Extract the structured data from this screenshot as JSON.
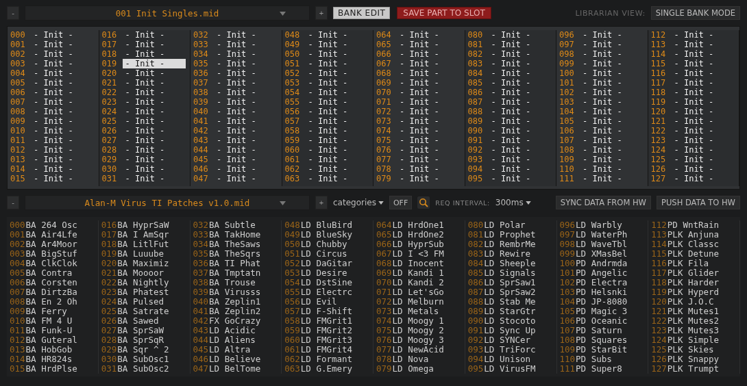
{
  "top_bar": {
    "minus": "-",
    "file": "001 Init Singles.mid",
    "plus": "+",
    "bank_edit": {
      "label": "BANK EDIT",
      "on": true
    },
    "save_button": "SAVE PART TO SLOT",
    "view_label": "LIBRARIAN VIEW:",
    "view_mode": "SINGLE BANK MODE"
  },
  "bank_patches": [
    {
      "number": "000",
      "name": "- Init -",
      "selected": false
    },
    {
      "number": "001",
      "name": "- Init -",
      "selected": false
    },
    {
      "number": "002",
      "name": "- Init -",
      "selected": false
    },
    {
      "number": "003",
      "name": "- Init -",
      "selected": false
    },
    {
      "number": "004",
      "name": "- Init -",
      "selected": false
    },
    {
      "number": "005",
      "name": "- Init -",
      "selected": false
    },
    {
      "number": "006",
      "name": "- Init -",
      "selected": false
    },
    {
      "number": "007",
      "name": "- Init -",
      "selected": false
    },
    {
      "number": "008",
      "name": "- Init -",
      "selected": false
    },
    {
      "number": "009",
      "name": "- Init -",
      "selected": false
    },
    {
      "number": "010",
      "name": "- Init -",
      "selected": false
    },
    {
      "number": "011",
      "name": "- Init -",
      "selected": false
    },
    {
      "number": "012",
      "name": "- Init -",
      "selected": false
    },
    {
      "number": "013",
      "name": "- Init -",
      "selected": false
    },
    {
      "number": "014",
      "name": "- Init -",
      "selected": false
    },
    {
      "number": "015",
      "name": "- Init -",
      "selected": false
    },
    {
      "number": "016",
      "name": "- Init -",
      "selected": false
    },
    {
      "number": "017",
      "name": "- Init -",
      "selected": false
    },
    {
      "number": "018",
      "name": "- Init -",
      "selected": false
    },
    {
      "number": "019",
      "name": "- Init -",
      "selected": true
    },
    {
      "number": "020",
      "name": "- Init -",
      "selected": false
    },
    {
      "number": "021",
      "name": "- Init -",
      "selected": false
    },
    {
      "number": "022",
      "name": "- Init -",
      "selected": false
    },
    {
      "number": "023",
      "name": "- Init -",
      "selected": false
    },
    {
      "number": "024",
      "name": "- Init -",
      "selected": false
    },
    {
      "number": "025",
      "name": "- Init -",
      "selected": false
    },
    {
      "number": "026",
      "name": "- Init -",
      "selected": false
    },
    {
      "number": "027",
      "name": "- Init -",
      "selected": false
    },
    {
      "number": "028",
      "name": "- Init -",
      "selected": false
    },
    {
      "number": "029",
      "name": "- Init -",
      "selected": false
    },
    {
      "number": "030",
      "name": "- Init -",
      "selected": false
    },
    {
      "number": "031",
      "name": "- Init -",
      "selected": false
    },
    {
      "number": "032",
      "name": "- Init -",
      "selected": false
    },
    {
      "number": "033",
      "name": "- Init -",
      "selected": false
    },
    {
      "number": "034",
      "name": "- Init -",
      "selected": false
    },
    {
      "number": "035",
      "name": "- Init -",
      "selected": false
    },
    {
      "number": "036",
      "name": "- Init -",
      "selected": false
    },
    {
      "number": "037",
      "name": "- Init -",
      "selected": false
    },
    {
      "number": "038",
      "name": "- Init -",
      "selected": false
    },
    {
      "number": "039",
      "name": "- Init -",
      "selected": false
    },
    {
      "number": "040",
      "name": "- Init -",
      "selected": false
    },
    {
      "number": "041",
      "name": "- Init -",
      "selected": false
    },
    {
      "number": "042",
      "name": "- Init -",
      "selected": false
    },
    {
      "number": "043",
      "name": "- Init -",
      "selected": false
    },
    {
      "number": "044",
      "name": "- Init -",
      "selected": false
    },
    {
      "number": "045",
      "name": "- Init -",
      "selected": false
    },
    {
      "number": "046",
      "name": "- Init -",
      "selected": false
    },
    {
      "number": "047",
      "name": "- Init -",
      "selected": false
    },
    {
      "number": "048",
      "name": "- Init -",
      "selected": false
    },
    {
      "number": "049",
      "name": "- Init -",
      "selected": false
    },
    {
      "number": "050",
      "name": "- Init -",
      "selected": false
    },
    {
      "number": "051",
      "name": "- Init -",
      "selected": false
    },
    {
      "number": "052",
      "name": "- Init -",
      "selected": false
    },
    {
      "number": "053",
      "name": "- Init -",
      "selected": false
    },
    {
      "number": "054",
      "name": "- Init -",
      "selected": false
    },
    {
      "number": "055",
      "name": "- Init -",
      "selected": false
    },
    {
      "number": "056",
      "name": "- Init -",
      "selected": false
    },
    {
      "number": "057",
      "name": "- Init -",
      "selected": false
    },
    {
      "number": "058",
      "name": "- Init -",
      "selected": false
    },
    {
      "number": "059",
      "name": "- Init -",
      "selected": false
    },
    {
      "number": "060",
      "name": "- Init -",
      "selected": false
    },
    {
      "number": "061",
      "name": "- Init -",
      "selected": false
    },
    {
      "number": "062",
      "name": "- Init -",
      "selected": false
    },
    {
      "number": "063",
      "name": "- Init -",
      "selected": false
    },
    {
      "number": "064",
      "name": "- Init -",
      "selected": false
    },
    {
      "number": "065",
      "name": "- Init -",
      "selected": false
    },
    {
      "number": "066",
      "name": "- Init -",
      "selected": false
    },
    {
      "number": "067",
      "name": "- Init -",
      "selected": false
    },
    {
      "number": "068",
      "name": "- Init -",
      "selected": false
    },
    {
      "number": "069",
      "name": "- Init -",
      "selected": false
    },
    {
      "number": "070",
      "name": "- Init -",
      "selected": false
    },
    {
      "number": "071",
      "name": "- Init -",
      "selected": false
    },
    {
      "number": "072",
      "name": "- Init -",
      "selected": false
    },
    {
      "number": "073",
      "name": "- Init -",
      "selected": false
    },
    {
      "number": "074",
      "name": "- Init -",
      "selected": false
    },
    {
      "number": "075",
      "name": "- Init -",
      "selected": false
    },
    {
      "number": "076",
      "name": "- Init -",
      "selected": false
    },
    {
      "number": "077",
      "name": "- Init -",
      "selected": false
    },
    {
      "number": "078",
      "name": "- Init -",
      "selected": false
    },
    {
      "number": "079",
      "name": "- Init -",
      "selected": false
    },
    {
      "number": "080",
      "name": "- Init -",
      "selected": false
    },
    {
      "number": "081",
      "name": "- Init -",
      "selected": false
    },
    {
      "number": "082",
      "name": "- Init -",
      "selected": false
    },
    {
      "number": "083",
      "name": "- Init -",
      "selected": false
    },
    {
      "number": "084",
      "name": "- Init -",
      "selected": false
    },
    {
      "number": "085",
      "name": "- Init -",
      "selected": false
    },
    {
      "number": "086",
      "name": "- Init -",
      "selected": false
    },
    {
      "number": "087",
      "name": "- Init -",
      "selected": false
    },
    {
      "number": "088",
      "name": "- Init -",
      "selected": false
    },
    {
      "number": "089",
      "name": "- Init -",
      "selected": false
    },
    {
      "number": "090",
      "name": "- Init -",
      "selected": false
    },
    {
      "number": "091",
      "name": "- Init -",
      "selected": false
    },
    {
      "number": "092",
      "name": "- Init -",
      "selected": false
    },
    {
      "number": "093",
      "name": "- Init -",
      "selected": false
    },
    {
      "number": "094",
      "name": "- Init -",
      "selected": false
    },
    {
      "number": "095",
      "name": "- Init -",
      "selected": false
    },
    {
      "number": "096",
      "name": "- Init -",
      "selected": false
    },
    {
      "number": "097",
      "name": "- Init -",
      "selected": false
    },
    {
      "number": "098",
      "name": "- Init -",
      "selected": false
    },
    {
      "number": "099",
      "name": "- Init -",
      "selected": false
    },
    {
      "number": "100",
      "name": "- Init -",
      "selected": false
    },
    {
      "number": "101",
      "name": "- Init -",
      "selected": false
    },
    {
      "number": "102",
      "name": "- Init -",
      "selected": false
    },
    {
      "number": "103",
      "name": "- Init -",
      "selected": false
    },
    {
      "number": "104",
      "name": "- Init -",
      "selected": false
    },
    {
      "number": "105",
      "name": "- Init -",
      "selected": false
    },
    {
      "number": "106",
      "name": "- Init -",
      "selected": false
    },
    {
      "number": "107",
      "name": "- Init -",
      "selected": false
    },
    {
      "number": "108",
      "name": "- Init -",
      "selected": false
    },
    {
      "number": "109",
      "name": "- Init -",
      "selected": false
    },
    {
      "number": "110",
      "name": "- Init -",
      "selected": false
    },
    {
      "number": "111",
      "name": "- Init -",
      "selected": false
    },
    {
      "number": "112",
      "name": "- Init -",
      "selected": false
    },
    {
      "number": "113",
      "name": "- Init -",
      "selected": false
    },
    {
      "number": "114",
      "name": "- Init -",
      "selected": false
    },
    {
      "number": "115",
      "name": "- Init -",
      "selected": false
    },
    {
      "number": "116",
      "name": "- Init -",
      "selected": false
    },
    {
      "number": "117",
      "name": "- Init -",
      "selected": false
    },
    {
      "number": "118",
      "name": "- Init -",
      "selected": false
    },
    {
      "number": "119",
      "name": "- Init -",
      "selected": false
    },
    {
      "number": "120",
      "name": "- Init -",
      "selected": false
    },
    {
      "number": "121",
      "name": "- Init -",
      "selected": false
    },
    {
      "number": "122",
      "name": "- Init -",
      "selected": false
    },
    {
      "number": "123",
      "name": "- Init -",
      "selected": false
    },
    {
      "number": "124",
      "name": "- Init -",
      "selected": false
    },
    {
      "number": "125",
      "name": "- Init -",
      "selected": false
    },
    {
      "number": "126",
      "name": "- Init -",
      "selected": false
    },
    {
      "number": "127",
      "name": "- Init -",
      "selected": false
    }
  ],
  "library_bar": {
    "minus": "-",
    "file": "Alan-M Virus TI Patches v1.0.mid",
    "plus": "+",
    "categories": "categories",
    "off_button": "OFF",
    "interval_label": "REQ INTERVAL:",
    "interval": "300ms",
    "sync_button": "SYNC DATA FROM HW",
    "push_button": "PUSH DATA TO HW"
  },
  "library_patches": [
    {
      "number": "000",
      "category": "BA",
      "name": "264 Osc"
    },
    {
      "number": "001",
      "category": "BA",
      "name": "Air4Lfe"
    },
    {
      "number": "002",
      "category": "BA",
      "name": "Ar4Moor"
    },
    {
      "number": "003",
      "category": "BA",
      "name": "BigStuf"
    },
    {
      "number": "004",
      "category": "BA",
      "name": "ClkClok"
    },
    {
      "number": "005",
      "category": "BA",
      "name": "Contra"
    },
    {
      "number": "006",
      "category": "BA",
      "name": "Corsten"
    },
    {
      "number": "007",
      "category": "BA",
      "name": "DirtzBa"
    },
    {
      "number": "008",
      "category": "BA",
      "name": "En 2 Oh"
    },
    {
      "number": "009",
      "category": "BA",
      "name": "Ferry"
    },
    {
      "number": "010",
      "category": "BA",
      "name": "FM 4 U"
    },
    {
      "number": "011",
      "category": "BA",
      "name": "Funk-U"
    },
    {
      "number": "012",
      "category": "BA",
      "name": "Guteral"
    },
    {
      "number": "013",
      "category": "BA",
      "name": "HobGob"
    },
    {
      "number": "014",
      "category": "BA",
      "name": "HR824s"
    },
    {
      "number": "015",
      "category": "BA",
      "name": "HrdPlse"
    },
    {
      "number": "016",
      "category": "BA",
      "name": "HyprSaW"
    },
    {
      "number": "017",
      "category": "BA",
      "name": "I AmSqr"
    },
    {
      "number": "018",
      "category": "BA",
      "name": "LitlFut"
    },
    {
      "number": "019",
      "category": "BA",
      "name": "Luuube"
    },
    {
      "number": "020",
      "category": "BA",
      "name": "Maximiz"
    },
    {
      "number": "021",
      "category": "BA",
      "name": "Moooor"
    },
    {
      "number": "022",
      "category": "BA",
      "name": "Nightly"
    },
    {
      "number": "023",
      "category": "BA",
      "name": "Phatest"
    },
    {
      "number": "024",
      "category": "BA",
      "name": "Pulsed"
    },
    {
      "number": "025",
      "category": "BA",
      "name": "Satrate"
    },
    {
      "number": "026",
      "category": "BA",
      "name": "Sawed"
    },
    {
      "number": "027",
      "category": "BA",
      "name": "SprSaW"
    },
    {
      "number": "028",
      "category": "BA",
      "name": "SprSqR"
    },
    {
      "number": "029",
      "category": "BA",
      "name": "Sqr ^ 2"
    },
    {
      "number": "030",
      "category": "BA",
      "name": "SubOsc1"
    },
    {
      "number": "031",
      "category": "BA",
      "name": "SubOsc2"
    },
    {
      "number": "032",
      "category": "BA",
      "name": "Subtle"
    },
    {
      "number": "033",
      "category": "BA",
      "name": "TakHome"
    },
    {
      "number": "034",
      "category": "BA",
      "name": "TheSaws"
    },
    {
      "number": "035",
      "category": "BA",
      "name": "TheSqrs"
    },
    {
      "number": "036",
      "category": "BA",
      "name": "TI Phat"
    },
    {
      "number": "037",
      "category": "BA",
      "name": "Tmptatn"
    },
    {
      "number": "038",
      "category": "BA",
      "name": "Trouse"
    },
    {
      "number": "039",
      "category": "BA",
      "name": "Virusss"
    },
    {
      "number": "040",
      "category": "BA",
      "name": "Zeplin1"
    },
    {
      "number": "041",
      "category": "BA",
      "name": "Zeplin2"
    },
    {
      "number": "042",
      "category": "FX",
      "name": "GoCrazy"
    },
    {
      "number": "043",
      "category": "LD",
      "name": "Acidic"
    },
    {
      "number": "044",
      "category": "LD",
      "name": "Aliens"
    },
    {
      "number": "045",
      "category": "LD",
      "name": "Altra"
    },
    {
      "number": "046",
      "category": "LD",
      "name": "Believe"
    },
    {
      "number": "047",
      "category": "LD",
      "name": "BelTome"
    },
    {
      "number": "048",
      "category": "LD",
      "name": "BluBird"
    },
    {
      "number": "049",
      "category": "LD",
      "name": "BlueSky"
    },
    {
      "number": "050",
      "category": "LD",
      "name": "Chubby"
    },
    {
      "number": "051",
      "category": "LD",
      "name": "Circus"
    },
    {
      "number": "052",
      "category": "LD",
      "name": "DaGitar"
    },
    {
      "number": "053",
      "category": "LD",
      "name": "Desire"
    },
    {
      "number": "054",
      "category": "LD",
      "name": "DstSine"
    },
    {
      "number": "055",
      "category": "LD",
      "name": "Electrc"
    },
    {
      "number": "056",
      "category": "LD",
      "name": "Evil"
    },
    {
      "number": "057",
      "category": "LD",
      "name": "F-Shift"
    },
    {
      "number": "058",
      "category": "LD",
      "name": "FMGrit1"
    },
    {
      "number": "059",
      "category": "LD",
      "name": "FMGrit2"
    },
    {
      "number": "060",
      "category": "LD",
      "name": "FMGrit3"
    },
    {
      "number": "061",
      "category": "LD",
      "name": "FMGrit4"
    },
    {
      "number": "062",
      "category": "LD",
      "name": "Formant"
    },
    {
      "number": "063",
      "category": "LD",
      "name": "G.Emery"
    },
    {
      "number": "064",
      "category": "LD",
      "name": "HrdOne1"
    },
    {
      "number": "065",
      "category": "LD",
      "name": "HrdOne2"
    },
    {
      "number": "066",
      "category": "LD",
      "name": "HyprSub"
    },
    {
      "number": "067",
      "category": "LD",
      "name": "I <3 FM"
    },
    {
      "number": "068",
      "category": "LD",
      "name": "Inocent"
    },
    {
      "number": "069",
      "category": "LD",
      "name": "Kandi 1"
    },
    {
      "number": "070",
      "category": "LD",
      "name": "Kandi 2"
    },
    {
      "number": "071",
      "category": "LD",
      "name": "Let'sGo"
    },
    {
      "number": "072",
      "category": "LD",
      "name": "Melburn"
    },
    {
      "number": "073",
      "category": "LD",
      "name": "Metals"
    },
    {
      "number": "074",
      "category": "LD",
      "name": "Moogy 1"
    },
    {
      "number": "075",
      "category": "LD",
      "name": "Moogy 2"
    },
    {
      "number": "076",
      "category": "LD",
      "name": "Moogy 3"
    },
    {
      "number": "077",
      "category": "LD",
      "name": "NewAcid"
    },
    {
      "number": "078",
      "category": "LD",
      "name": "Nova"
    },
    {
      "number": "079",
      "category": "LD",
      "name": "Omega"
    },
    {
      "number": "080",
      "category": "LD",
      "name": "Polar"
    },
    {
      "number": "081",
      "category": "LD",
      "name": "Prophet"
    },
    {
      "number": "082",
      "category": "LD",
      "name": "RembrMe"
    },
    {
      "number": "083",
      "category": "LD",
      "name": "Rewire"
    },
    {
      "number": "084",
      "category": "LD",
      "name": "Sheeple"
    },
    {
      "number": "085",
      "category": "LD",
      "name": "Signals"
    },
    {
      "number": "086",
      "category": "LD",
      "name": "SprSaw1"
    },
    {
      "number": "087",
      "category": "LD",
      "name": "SprSaw2"
    },
    {
      "number": "088",
      "category": "LD",
      "name": "Stab Me"
    },
    {
      "number": "089",
      "category": "LD",
      "name": "StarGtr"
    },
    {
      "number": "090",
      "category": "LD",
      "name": "Stocoto"
    },
    {
      "number": "091",
      "category": "LD",
      "name": "Sync Up"
    },
    {
      "number": "092",
      "category": "LD",
      "name": "SYNCer"
    },
    {
      "number": "093",
      "category": "LD",
      "name": "TriForc"
    },
    {
      "number": "094",
      "category": "LD",
      "name": "Unison"
    },
    {
      "number": "095",
      "category": "LD",
      "name": "VirusFM"
    },
    {
      "number": "096",
      "category": "LD",
      "name": "Warbly"
    },
    {
      "number": "097",
      "category": "LD",
      "name": "WaterPh"
    },
    {
      "number": "098",
      "category": "LD",
      "name": "WaveTbl"
    },
    {
      "number": "099",
      "category": "LD",
      "name": "XMasBel"
    },
    {
      "number": "100",
      "category": "PD",
      "name": "Andrmda"
    },
    {
      "number": "101",
      "category": "PD",
      "name": "Angelic"
    },
    {
      "number": "102",
      "category": "PD",
      "name": "Electra"
    },
    {
      "number": "103",
      "category": "PD",
      "name": "Helsnki"
    },
    {
      "number": "104",
      "category": "PD",
      "name": "JP-8080"
    },
    {
      "number": "105",
      "category": "PD",
      "name": "Magic 3"
    },
    {
      "number": "106",
      "category": "PD",
      "name": "Oceanic"
    },
    {
      "number": "107",
      "category": "PD",
      "name": "Saturn"
    },
    {
      "number": "108",
      "category": "PD",
      "name": "Squares"
    },
    {
      "number": "109",
      "category": "PD",
      "name": "StarBit"
    },
    {
      "number": "110",
      "category": "PD",
      "name": "Subs"
    },
    {
      "number": "111",
      "category": "PD",
      "name": "Super8"
    },
    {
      "number": "112",
      "category": "PD",
      "name": "WntRain"
    },
    {
      "number": "113",
      "category": "PLK",
      "name": "Anjuna"
    },
    {
      "number": "114",
      "category": "PLK",
      "name": "Classc"
    },
    {
      "number": "115",
      "category": "PLK",
      "name": "Detune"
    },
    {
      "number": "116",
      "category": "PLK",
      "name": "Fila"
    },
    {
      "number": "117",
      "category": "PLK",
      "name": "Glider"
    },
    {
      "number": "118",
      "category": "PLK",
      "name": "Harder"
    },
    {
      "number": "119",
      "category": "PLK",
      "name": "Hyperd"
    },
    {
      "number": "120",
      "category": "PLK",
      "name": "J.O.C"
    },
    {
      "number": "121",
      "category": "PLK",
      "name": "Mutes1"
    },
    {
      "number": "122",
      "category": "PLK",
      "name": "Mutes2"
    },
    {
      "number": "123",
      "category": "PLK",
      "name": "Mutes3"
    },
    {
      "number": "124",
      "category": "PLK",
      "name": "Simple"
    },
    {
      "number": "125",
      "category": "PLK",
      "name": "Skies"
    },
    {
      "number": "126",
      "category": "PLK",
      "name": "Snappy"
    },
    {
      "number": "127",
      "category": "PLK",
      "name": "Trumpt"
    }
  ]
}
